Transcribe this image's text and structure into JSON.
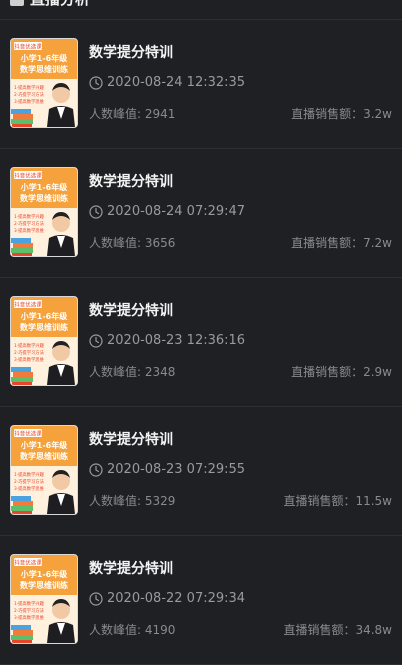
{
  "header": {
    "title": "直播分析"
  },
  "items": [
    {
      "title": "数学提分特训",
      "time": "2020-08-24 12:32:35",
      "peak_label": "人数峰值: 2941",
      "sales_label": "直播销售额：3.2w"
    },
    {
      "title": "数学提分特训",
      "time": "2020-08-24 07:29:47",
      "peak_label": "人数峰值: 3656",
      "sales_label": "直播销售额：7.2w"
    },
    {
      "title": "数学提分特训",
      "time": "2020-08-23 12:36:16",
      "peak_label": "人数峰值: 2348",
      "sales_label": "直播销售额：2.9w"
    },
    {
      "title": "数学提分特训",
      "time": "2020-08-23 07:29:55",
      "peak_label": "人数峰值: 5329",
      "sales_label": "直播销售额：11.5w"
    },
    {
      "title": "数学提分特训",
      "time": "2020-08-22 07:29:34",
      "peak_label": "人数峰值: 4190",
      "sales_label": "直播销售额：34.8w"
    }
  ],
  "thumbnail": {
    "badge": "抖音优选课",
    "line1": "小学1-6年级",
    "line2": "数学思维训练",
    "bullets": [
      "1·提高数学兴趣",
      "2·巧提学习方法",
      "3·提高数学思维"
    ]
  },
  "colors": {
    "bg": "#1f2024",
    "accent": "#e8452b",
    "divider": "#2e2f34"
  },
  "icons": {
    "clock": "clock-icon",
    "header": "document-icon"
  }
}
